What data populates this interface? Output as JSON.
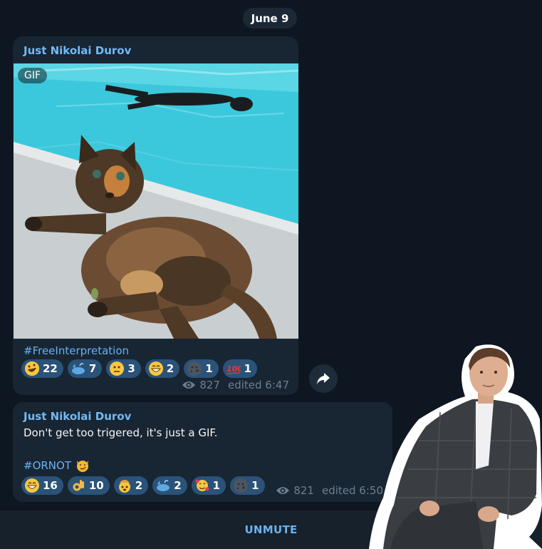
{
  "date": "June 9",
  "messages": [
    {
      "sender": "Just Nikolai Durov",
      "media_badge": "GIF",
      "hashtag": "#FreeInterpretation",
      "reactions": [
        {
          "icon": "rofl-emoji",
          "count": "22"
        },
        {
          "icon": "whale-emoji",
          "count": "7"
        },
        {
          "icon": "neutral-face-emoji",
          "count": "3"
        },
        {
          "icon": "grinning-face-emoji",
          "count": "2"
        },
        {
          "icon": "new-moon-face-emoji",
          "count": "1"
        },
        {
          "icon": "hundred-points-emoji",
          "count": "1"
        }
      ],
      "views": "827",
      "edited": "edited 6:47"
    },
    {
      "sender": "Just Nikolai Durov",
      "text": "Don't get too trigered, it's just a GIF.",
      "hashtag": "#ORNOT",
      "reactions": [
        {
          "icon": "grinning-face-emoji",
          "count": "16"
        },
        {
          "icon": "ok-hand-emoji",
          "count": "10"
        },
        {
          "icon": "exploding-head-emoji",
          "count": "2"
        },
        {
          "icon": "whale-emoji",
          "count": "2"
        },
        {
          "icon": "smiling-face-hearts-emoji",
          "count": "1"
        },
        {
          "icon": "new-moon-face-emoji",
          "count": "1"
        }
      ],
      "views": "821",
      "edited": "edited 6:50"
    }
  ],
  "bottom_bar": {
    "unmute_label": "UNMUTE"
  },
  "colors": {
    "background": "#0e1621",
    "bubble": "#182533",
    "accent": "#6ab2f2",
    "reaction": "#2b5278"
  }
}
